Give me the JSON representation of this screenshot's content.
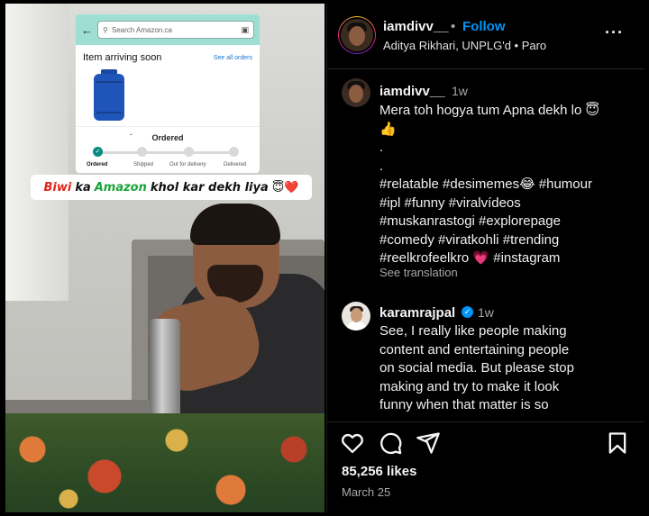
{
  "media": {
    "amazon": {
      "search_placeholder": "Search Amazon.ca",
      "section_title": "Item arriving soon",
      "see_all": "See all orders",
      "status": "Ordered",
      "dash": "-",
      "steps": [
        "Ordered",
        "Shipped",
        "Out for delivery",
        "Delivered"
      ]
    },
    "caption": {
      "word1": "Biwi",
      "word2": "ka",
      "word3": "Amazon",
      "word4": "khol kar dekh liya",
      "emoji": "😇❤️"
    }
  },
  "header": {
    "username": "iamdivv__",
    "dot": "•",
    "follow_label": "Follow",
    "subtitle": "Aditya Rikhari, UNPLG'd • Paro",
    "more_icon": "more-horizontal-icon"
  },
  "comments": [
    {
      "username": "iamdivv__",
      "time": "1w",
      "lines": [
        "Mera toh hogya tum Apna dekh lo 😇",
        "👍",
        ".",
        ".",
        "#relatable #desimemes😂 #humour",
        "#ipl #funny #viralvídeos",
        "#muskanrastogi #explorepage",
        "#comedy #viratkohli #trending",
        "#reelkrofeelkro 💗 #instagram"
      ],
      "see_translation": "See translation"
    },
    {
      "username": "karamrajpal",
      "verified": true,
      "time": "1w",
      "lines": [
        "See, I really like people making",
        "content and entertaining people",
        "on social media. But please stop",
        "making and try to make it look",
        "funny when that matter is so"
      ]
    }
  ],
  "actions": {
    "like_icon": "heart-icon",
    "comment_icon": "comment-icon",
    "share_icon": "send-icon",
    "save_icon": "bookmark-icon"
  },
  "likes": "85,256 likes",
  "date": "March 25",
  "colors": {
    "follow": "#0095f6",
    "background": "#000000",
    "muted": "#a8a8a8"
  }
}
